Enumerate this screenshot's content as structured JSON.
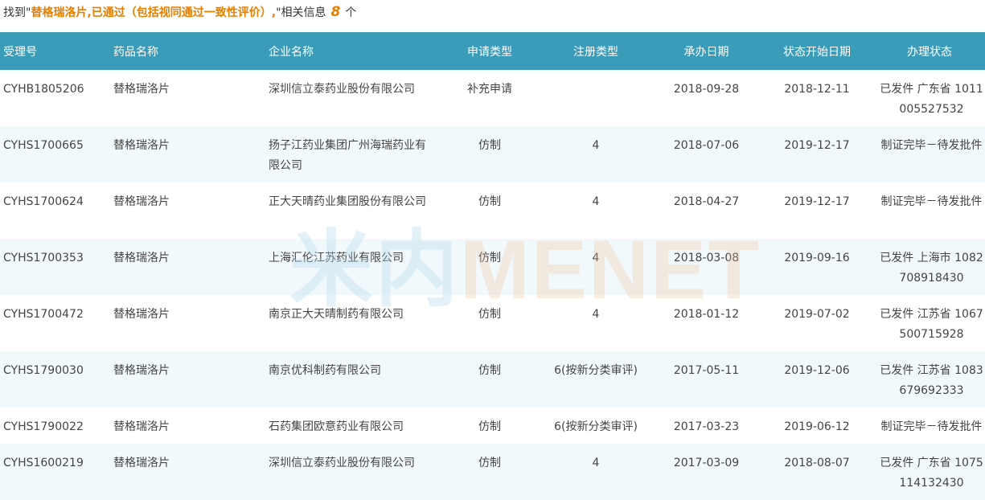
{
  "summary": {
    "prefix": "找到\"",
    "query": "替格瑞洛片,已通过（包括视同通过一致性评价）,",
    "middle": "\"相关信息",
    "count": "8",
    "suffix": "个"
  },
  "watermark": {
    "cn": "米内",
    "en": "MENET"
  },
  "table": {
    "headers": [
      "受理号",
      "药品名称",
      "企业名称",
      "申请类型",
      "注册类型",
      "承办日期",
      "状态开始日期",
      "办理状态"
    ],
    "rows": [
      [
        "CYHB1805206",
        "替格瑞洛片",
        "深圳信立泰药业股份有限公司",
        "补充申请",
        "",
        "2018-09-28",
        "2018-12-11",
        "已发件 广东省 1011005527532"
      ],
      [
        "CYHS1700665",
        "替格瑞洛片",
        "扬子江药业集团广州海瑞药业有限公司",
        "仿制",
        "4",
        "2018-07-06",
        "2019-12-17",
        "制证完毕－待发批件"
      ],
      [
        "CYHS1700624",
        "替格瑞洛片",
        "正大天晴药业集团股份有限公司",
        "仿制",
        "4",
        "2018-04-27",
        "2019-12-17",
        "制证完毕－待发批件"
      ],
      [
        "CYHS1700353",
        "替格瑞洛片",
        "上海汇伦江苏药业有限公司",
        "仿制",
        "4",
        "2018-03-08",
        "2019-09-16",
        "已发件 上海市 1082708918430"
      ],
      [
        "CYHS1700472",
        "替格瑞洛片",
        "南京正大天晴制药有限公司",
        "仿制",
        "4",
        "2018-01-12",
        "2019-07-02",
        "已发件 江苏省 1067500715928"
      ],
      [
        "CYHS1790030",
        "替格瑞洛片",
        "南京优科制药有限公司",
        "仿制",
        "6(按新分类审评)",
        "2017-05-11",
        "2019-12-06",
        "已发件 江苏省 1083679692333"
      ],
      [
        "CYHS1790022",
        "替格瑞洛片",
        "石药集团欧意药业有限公司",
        "仿制",
        "6(按新分类审评)",
        "2017-03-23",
        "2019-06-12",
        "制证完毕－待发批件"
      ],
      [
        "CYHS1600219",
        "替格瑞洛片",
        "深圳信立泰药业股份有限公司",
        "仿制",
        "4",
        "2017-03-09",
        "2018-08-07",
        "已发件 广东省 1075114132430"
      ]
    ]
  }
}
